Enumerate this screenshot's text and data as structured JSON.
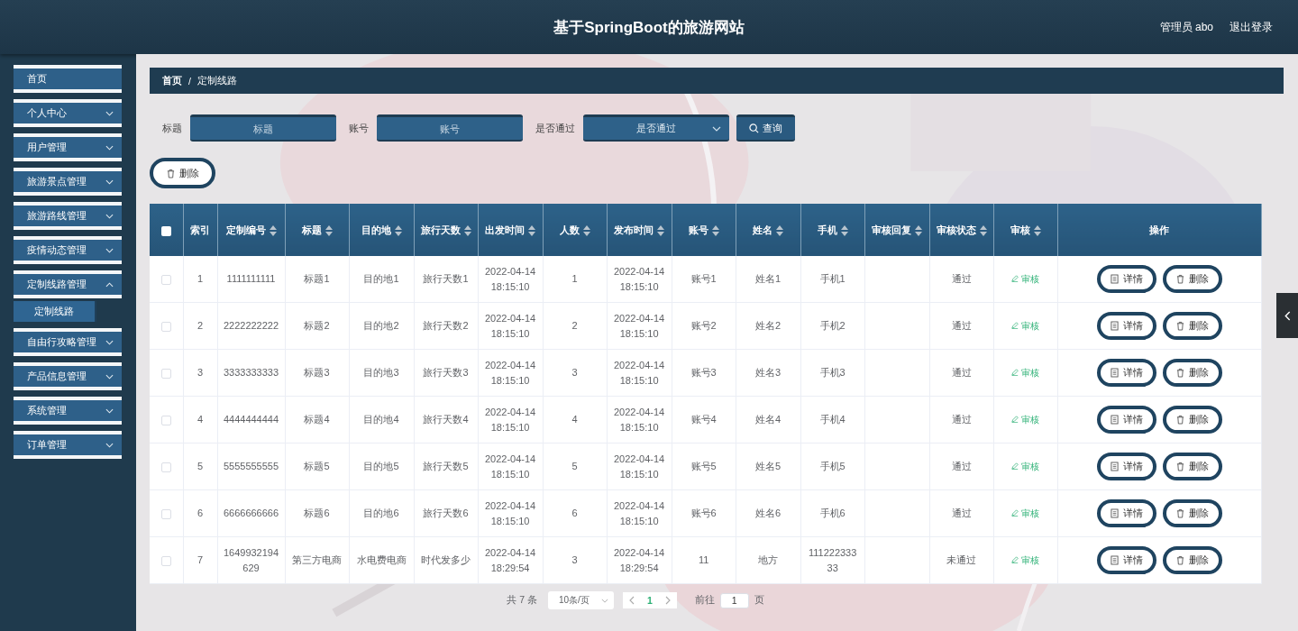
{
  "header": {
    "title": "基于SpringBoot的旅游网站",
    "user": "管理员 abo",
    "logout": "退出登录"
  },
  "menu": [
    {
      "label": "首页",
      "kind": "link"
    },
    {
      "label": "个人中心",
      "kind": "submenu",
      "expanded": false
    },
    {
      "label": "用户管理",
      "kind": "submenu",
      "expanded": false
    },
    {
      "label": "旅游景点管理",
      "kind": "submenu",
      "expanded": false
    },
    {
      "label": "旅游路线管理",
      "kind": "submenu",
      "expanded": false
    },
    {
      "label": "疫情动态管理",
      "kind": "submenu",
      "expanded": false
    },
    {
      "label": "定制线路管理",
      "kind": "submenu",
      "expanded": true,
      "children": [
        {
          "label": "定制线路",
          "selected": true
        }
      ]
    },
    {
      "label": "自由行攻略管理",
      "kind": "submenu",
      "expanded": false
    },
    {
      "label": "产品信息管理",
      "kind": "submenu",
      "expanded": false
    },
    {
      "label": "系统管理",
      "kind": "submenu",
      "expanded": false
    },
    {
      "label": "订单管理",
      "kind": "submenu",
      "expanded": false
    }
  ],
  "breadcrumb": {
    "items": [
      "首页",
      "定制线路"
    ],
    "separator": "/"
  },
  "filters": [
    {
      "kind": "input",
      "label": "标题",
      "placeholder": "标题"
    },
    {
      "kind": "input",
      "label": "账号",
      "placeholder": "账号"
    },
    {
      "kind": "select",
      "label": "是否通过",
      "placeholder": "是否通过"
    }
  ],
  "search_button": "查询",
  "delete_button": "删除",
  "table": {
    "select_all": false,
    "columns": [
      {
        "kind": "checkbox"
      },
      {
        "kind": "data",
        "label": "索引",
        "sortable": false
      },
      {
        "kind": "data",
        "label": "定制编号",
        "sortable": true
      },
      {
        "kind": "data",
        "label": "标题",
        "sortable": true
      },
      {
        "kind": "data",
        "label": "目的地",
        "sortable": true
      },
      {
        "kind": "data",
        "label": "旅行天数",
        "sortable": true
      },
      {
        "kind": "data",
        "label": "出发时间",
        "sortable": true
      },
      {
        "kind": "data",
        "label": "人数",
        "sortable": true
      },
      {
        "kind": "data",
        "label": "发布时间",
        "sortable": true
      },
      {
        "kind": "data",
        "label": "账号",
        "sortable": true
      },
      {
        "kind": "data",
        "label": "姓名",
        "sortable": true
      },
      {
        "kind": "data",
        "label": "手机",
        "sortable": true
      },
      {
        "kind": "data",
        "label": "审核回复",
        "sortable": true
      },
      {
        "kind": "data",
        "label": "审核状态",
        "sortable": true
      },
      {
        "kind": "review",
        "label": "审核",
        "sortable": true
      },
      {
        "kind": "actions",
        "label": "操作",
        "sortable": false
      }
    ],
    "rows": [
      {
        "checked": false,
        "cells": [
          null,
          "1",
          "1111111111",
          "标题1",
          "目的地1",
          "旅行天数1",
          "2022-04-14 18:15:10",
          "1",
          "2022-04-14 18:15:10",
          "账号1",
          "姓名1",
          "手机1",
          null,
          "通过"
        ],
        "review": "审核",
        "actions": [
          "详情",
          "删除"
        ]
      },
      {
        "checked": false,
        "cells": [
          null,
          "2",
          "2222222222",
          "标题2",
          "目的地2",
          "旅行天数2",
          "2022-04-14 18:15:10",
          "2",
          "2022-04-14 18:15:10",
          "账号2",
          "姓名2",
          "手机2",
          null,
          "通过"
        ],
        "review": "审核",
        "actions": [
          "详情",
          "删除"
        ]
      },
      {
        "checked": false,
        "cells": [
          null,
          "3",
          "3333333333",
          "标题3",
          "目的地3",
          "旅行天数3",
          "2022-04-14 18:15:10",
          "3",
          "2022-04-14 18:15:10",
          "账号3",
          "姓名3",
          "手机3",
          null,
          "通过"
        ],
        "review": "审核",
        "actions": [
          "详情",
          "删除"
        ]
      },
      {
        "checked": false,
        "cells": [
          null,
          "4",
          "4444444444",
          "标题4",
          "目的地4",
          "旅行天数4",
          "2022-04-14 18:15:10",
          "4",
          "2022-04-14 18:15:10",
          "账号4",
          "姓名4",
          "手机4",
          null,
          "通过"
        ],
        "review": "审核",
        "actions": [
          "详情",
          "删除"
        ]
      },
      {
        "checked": false,
        "cells": [
          null,
          "5",
          "5555555555",
          "标题5",
          "目的地5",
          "旅行天数5",
          "2022-04-14 18:15:10",
          "5",
          "2022-04-14 18:15:10",
          "账号5",
          "姓名5",
          "手机5",
          null,
          "通过"
        ],
        "review": "审核",
        "actions": [
          "详情",
          "删除"
        ]
      },
      {
        "checked": false,
        "cells": [
          null,
          "6",
          "6666666666",
          "标题6",
          "目的地6",
          "旅行天数6",
          "2022-04-14 18:15:10",
          "6",
          "2022-04-14 18:15:10",
          "账号6",
          "姓名6",
          "手机6",
          null,
          "通过"
        ],
        "review": "审核",
        "actions": [
          "详情",
          "删除"
        ]
      },
      {
        "checked": false,
        "cells": [
          null,
          "7",
          "1649932194629",
          "第三方电商",
          "水电费电商",
          "时代发多少",
          "2022-04-14 18:29:54",
          "3",
          "2022-04-14 18:29:54",
          "11",
          "地方",
          "11122233333",
          null,
          "未通过"
        ],
        "review": "审核",
        "actions": [
          "详情",
          "删除"
        ]
      }
    ]
  },
  "pagination": {
    "total": "共 7 条",
    "page_size": "10条/页",
    "pages": [
      {
        "label": "1",
        "selected": true
      }
    ],
    "goto_label": "前往",
    "goto_value": "1",
    "goto_suffix": "页"
  }
}
